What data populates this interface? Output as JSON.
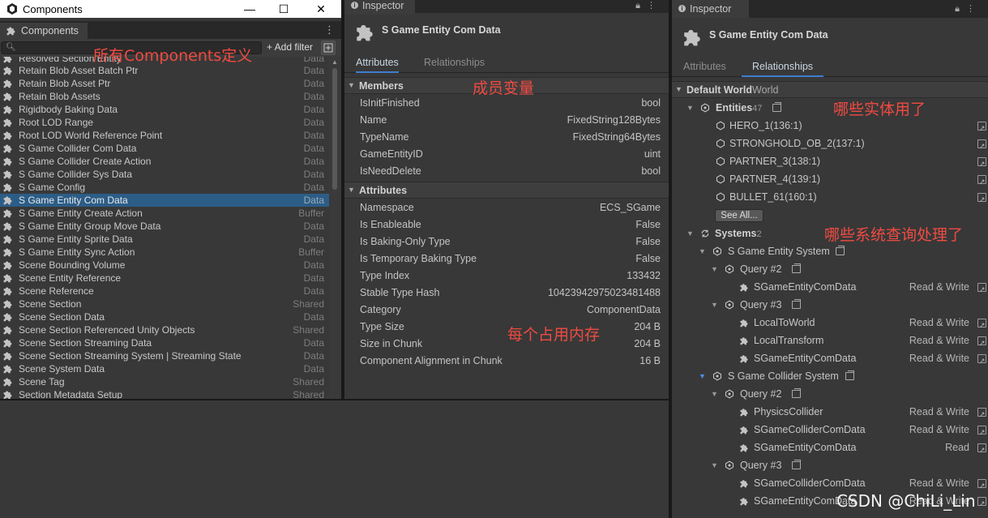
{
  "components_window": {
    "title": "Components",
    "tab_label": "Components",
    "add_filter": "+ Add filter",
    "rows": [
      {
        "label": "Resolved Section Entity",
        "type": "Data"
      },
      {
        "label": "Retain Blob Asset Batch Ptr",
        "type": "Data"
      },
      {
        "label": "Retain Blob Asset Ptr",
        "type": "Data"
      },
      {
        "label": "Retain Blob Assets",
        "type": "Data"
      },
      {
        "label": "Rigidbody Baking Data",
        "type": "Data"
      },
      {
        "label": "Root LOD Range",
        "type": "Data"
      },
      {
        "label": "Root LOD World Reference Point",
        "type": "Data"
      },
      {
        "label": "S Game Collider Com Data",
        "type": "Data"
      },
      {
        "label": "S Game Collider Create Action",
        "type": "Data"
      },
      {
        "label": "S Game Collider Sys Data",
        "type": "Data"
      },
      {
        "label": "S Game Config",
        "type": "Data"
      },
      {
        "label": "S Game Entity Com Data",
        "type": "Data",
        "selected": true
      },
      {
        "label": "S Game Entity Create Action",
        "type": "Buffer"
      },
      {
        "label": "S Game Entity Group Move Data",
        "type": "Data"
      },
      {
        "label": "S Game Entity Sprite Data",
        "type": "Data"
      },
      {
        "label": "S Game Entity Sync Action",
        "type": "Buffer"
      },
      {
        "label": "Scene Bounding Volume",
        "type": "Data"
      },
      {
        "label": "Scene Entity Reference",
        "type": "Data"
      },
      {
        "label": "Scene Reference",
        "type": "Data"
      },
      {
        "label": "Scene Section",
        "type": "Shared"
      },
      {
        "label": "Scene Section Data",
        "type": "Data"
      },
      {
        "label": "Scene Section Referenced Unity Objects",
        "type": "Shared"
      },
      {
        "label": "Scene Section Streaming Data",
        "type": "Data"
      },
      {
        "label": "Scene Section Streaming System | Streaming State",
        "type": "Data"
      },
      {
        "label": "Scene System Data",
        "type": "Data"
      },
      {
        "label": "Scene Tag",
        "type": "Shared"
      },
      {
        "label": "Section Metadata Setup",
        "type": "Shared"
      }
    ]
  },
  "inspector_members": {
    "tab": "Inspector",
    "title": "S Game Entity Com Data",
    "subtab_attributes": "Attributes",
    "subtab_relationships": "Relationships",
    "members_header": "Members",
    "members": [
      {
        "k": "IsInitFinished",
        "v": "bool"
      },
      {
        "k": "Name",
        "v": "FixedString128Bytes"
      },
      {
        "k": "TypeName",
        "v": "FixedString64Bytes"
      },
      {
        "k": "GameEntityID",
        "v": "uint"
      },
      {
        "k": "IsNeedDelete",
        "v": "bool"
      }
    ],
    "attributes_header": "Attributes",
    "attributes": [
      {
        "k": "Namespace",
        "v": "ECS_SGame"
      },
      {
        "k": "Is Enableable",
        "v": "False"
      },
      {
        "k": "Is Baking-Only Type",
        "v": "False"
      },
      {
        "k": "Is Temporary Baking Type",
        "v": "False"
      },
      {
        "k": "Type Index",
        "v": "133432"
      },
      {
        "k": "Stable Type Hash",
        "v": "10423942975023481488"
      },
      {
        "k": "Category",
        "v": "ComponentData"
      },
      {
        "k": "Type Size",
        "v": "204 B"
      },
      {
        "k": "Size in Chunk",
        "v": "204 B"
      },
      {
        "k": "Component Alignment in Chunk",
        "v": "16 B"
      }
    ]
  },
  "inspector_relationships": {
    "tab": "Inspector",
    "title": "S Game Entity Com Data",
    "subtab_attributes": "Attributes",
    "subtab_relationships": "Relationships",
    "world_label": "Default World",
    "world_suffix": "World",
    "entities_label": "Entities",
    "entities_count": "47",
    "entities": [
      "HERO_1(136:1)",
      "STRONGHOLD_OB_2(137:1)",
      "PARTNER_3(138:1)",
      "PARTNER_4(139:1)",
      "BULLET_61(160:1)"
    ],
    "see_all": "See All...",
    "systems_label": "Systems",
    "systems_count": "2",
    "sys1_name": "S Game Entity System",
    "sys1_q1": "Query #2",
    "sys1_q1_c1": "SGameEntityComData",
    "sys1_q1_c1_acc": "Read & Write",
    "sys1_q2": "Query #3",
    "sys1_q2_c1": "LocalToWorld",
    "sys1_q2_c1_acc": "Read & Write",
    "sys1_q2_c2": "LocalTransform",
    "sys1_q2_c2_acc": "Read & Write",
    "sys1_q2_c3": "SGameEntityComData",
    "sys1_q2_c3_acc": "Read & Write",
    "sys2_name": "S Game Collider System",
    "sys2_q1": "Query #2",
    "sys2_q1_c1": "PhysicsCollider",
    "sys2_q1_c1_acc": "Read & Write",
    "sys2_q1_c2": "SGameColliderComData",
    "sys2_q1_c2_acc": "Read & Write",
    "sys2_q1_c3": "SGameEntityComData",
    "sys2_q1_c3_acc": "Read",
    "sys2_q2": "Query #3",
    "sys2_q2_c1": "SGameColliderComData",
    "sys2_q2_c1_acc": "Read & Write",
    "sys2_q2_c2": "SGameEntityComData",
    "sys2_q2_c2_acc": "Read & Write"
  },
  "annotations": {
    "all_components": "所有Components定义",
    "members": "成员变量",
    "entities_used": "哪些实体用了",
    "memory": "每个占用内存",
    "systems_query": "哪些系统查询处理了"
  },
  "watermark": "CSDN @ChiLi_Lin"
}
